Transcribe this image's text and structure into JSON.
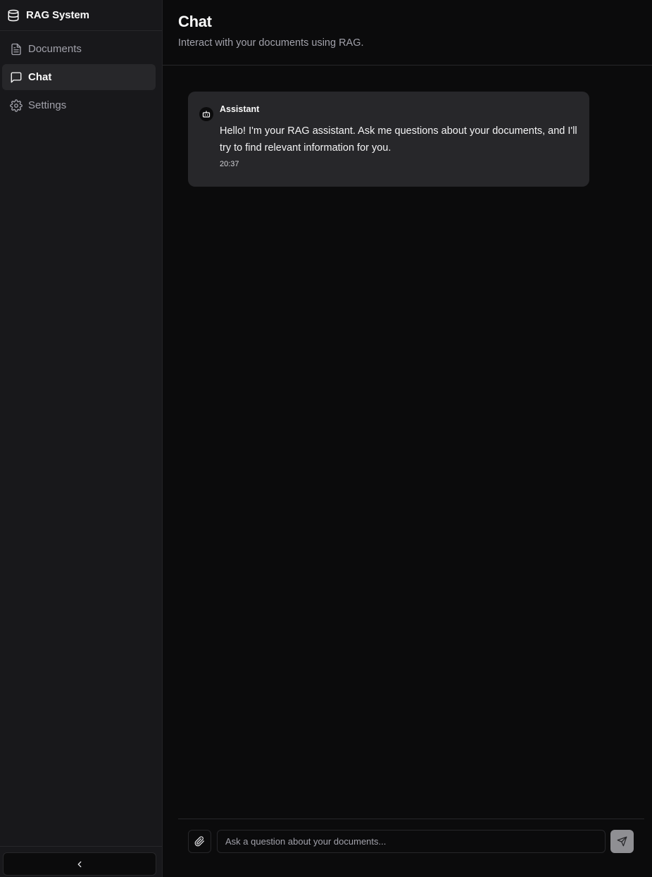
{
  "sidebar": {
    "brand": {
      "label": "RAG System",
      "icon": "database-icon"
    },
    "items": [
      {
        "label": "Documents",
        "icon": "file-text-icon",
        "active": false
      },
      {
        "label": "Chat",
        "icon": "message-square-icon",
        "active": true
      },
      {
        "label": "Settings",
        "icon": "gear-icon",
        "active": false
      }
    ],
    "collapse_icon": "chevron-left-icon"
  },
  "header": {
    "title": "Chat",
    "subtitle": "Interact with your documents using RAG."
  },
  "messages": [
    {
      "sender": "Assistant",
      "icon": "bot-icon",
      "text": "Hello! I'm your RAG assistant. Ask me questions about your documents, and I'll try to find relevant information for you.",
      "time": "20:37"
    }
  ],
  "composer": {
    "placeholder": "Ask a question about your documents...",
    "value": "",
    "attach_icon": "paperclip-icon",
    "send_icon": "send-icon"
  },
  "colors": {
    "background": "#0b0b0c",
    "sidebar": "#18181b",
    "active_item": "#27272a",
    "message_bubble": "#27272a",
    "send_button": "#8f8f93"
  }
}
